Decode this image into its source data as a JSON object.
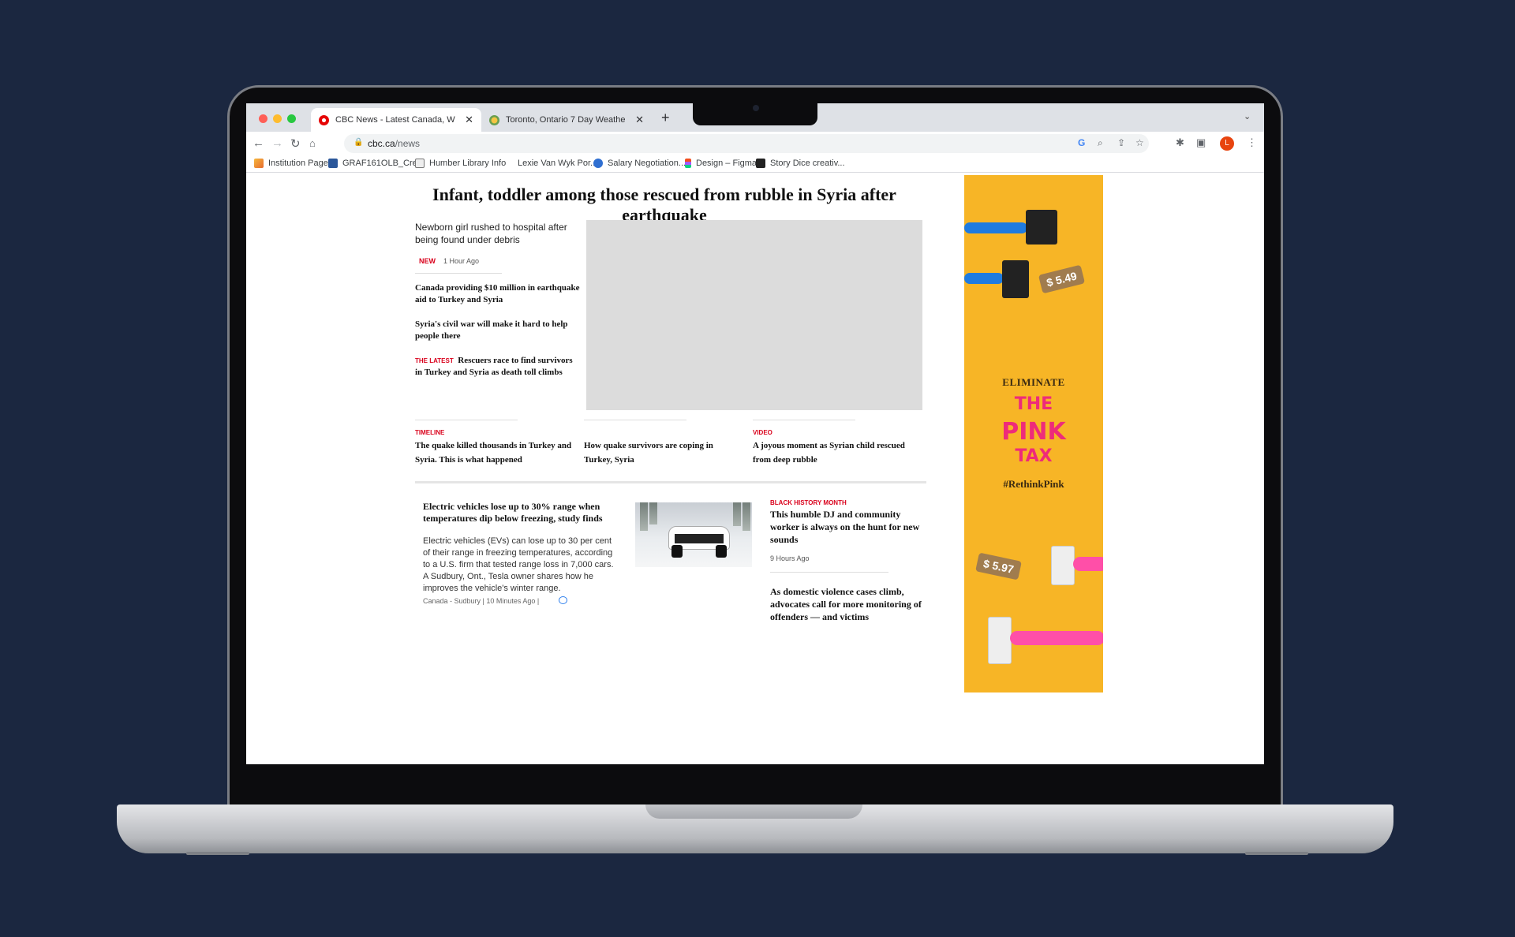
{
  "browser": {
    "tabs": [
      {
        "title": "CBC News - Latest Canada, W",
        "close": "✕",
        "active": true
      },
      {
        "title": "Toronto, Ontario 7 Day Weathe",
        "close": "✕",
        "active": false
      }
    ],
    "new_tab": "+",
    "url_host": "cbc.ca",
    "url_path": "/news",
    "avatar_letter": "L",
    "bookmarks": [
      "Institution Page",
      "GRAF161OLB_Cre...",
      "Humber Library Info",
      "Lexie Van Wyk Por...",
      "Salary Negotiation...",
      "Design – Figma",
      "Story Dice creativ..."
    ]
  },
  "page": {
    "headline": "Infant, toddler among those rescued from rubble in Syria after earthquake",
    "lead_sub": "Newborn girl rushed to hospital after being found under debris",
    "lead_badge": "NEW",
    "lead_time": "1 Hour Ago",
    "side_links": [
      {
        "kicker": "",
        "text": "Canada providing $10 million in earthquake aid to Turkey and Syria"
      },
      {
        "kicker": "",
        "text": "Syria's civil war will make it hard to help people there"
      },
      {
        "kicker": "THE LATEST",
        "text": "Rescuers race to find survivors in Turkey and Syria as death toll climbs"
      }
    ],
    "tri_links": [
      {
        "kicker": "TIMELINE",
        "text": "The quake killed thousands in Turkey and Syria. This is what happened"
      },
      {
        "kicker": "",
        "text": "How quake survivors are coping in Turkey, Syria"
      },
      {
        "kicker": "VIDEO",
        "text": "A joyous moment as Syrian child rescued from deep rubble"
      }
    ],
    "story": {
      "headline": "Electric vehicles lose up to 30% range when temperatures dip below freezing, study finds",
      "body": "Electric vehicles (EVs) can lose up to 30 per cent of their range in freezing temperatures, according to a U.S. firm that tested range loss in 7,000 cars. A Sudbury, Ont., Tesla owner shares how he improves the vehicle's winter range.",
      "meta": "Canada  - Sudbury  |  10 Minutes Ago  |"
    },
    "right_stories": [
      {
        "kicker": "BLACK HISTORY MONTH",
        "text": "This humble DJ and community worker is always on the hunt for new sounds",
        "time": "9 Hours Ago"
      },
      {
        "kicker": "",
        "text": "As domestic violence cases climb, advocates call for more monitoring of offenders — and victims",
        "time": ""
      }
    ]
  },
  "ad": {
    "price_1": "$ 5.49",
    "price_2": "$ 5.97",
    "line_1": "ELIMINATE",
    "line_2": "THE",
    "line_3": "PINK",
    "line_4": "TAX",
    "hashtag": "#RethinkPink",
    "colors": {
      "background": "#f7b526",
      "pink": "#ee2b7a",
      "blue": "#1f7be0"
    }
  }
}
